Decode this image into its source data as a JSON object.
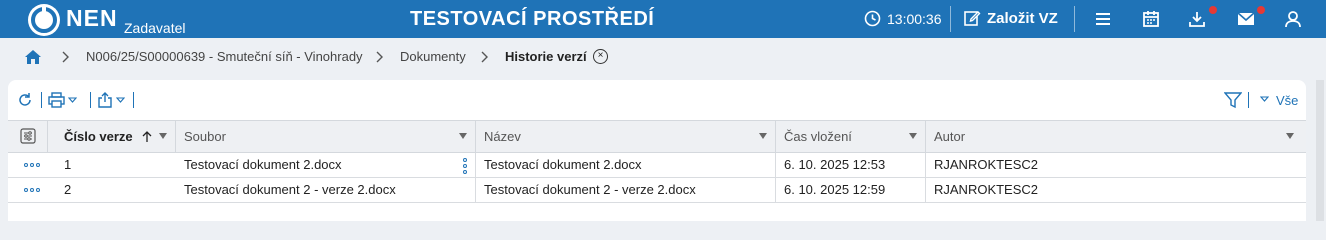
{
  "header": {
    "logo": "NEN",
    "role": "Zadavatel",
    "environment": "TESTOVACÍ PROSTŘEDÍ",
    "time": "13:00:36",
    "create_label": "Založit VZ",
    "icons": [
      "menu-icon",
      "calendar-icon",
      "download-icon",
      "mail-icon",
      "user-icon"
    ],
    "accent": "#1f73b7",
    "notification_color": "#e53935"
  },
  "breadcrumb": {
    "items": [
      "N006/25/S00000639 - Smuteční síň - Vinohrady",
      "Dokumenty",
      "Historie verzí"
    ],
    "close_symbol": "×"
  },
  "toolbar": {
    "filter_all": "Vše"
  },
  "table": {
    "columns": [
      "Číslo verze",
      "Soubor",
      "Název",
      "Čas vložení",
      "Autor"
    ],
    "rows": [
      {
        "verze": "1",
        "soubor": "Testovací dokument 2.docx",
        "nazev": "Testovací dokument 2.docx",
        "cas": "6. 10. 2025 12:53",
        "autor": "RJANROKTESC2"
      },
      {
        "verze": "2",
        "soubor": "Testovací dokument 2 - verze 2.docx",
        "nazev": "Testovací dokument 2 - verze 2.docx",
        "cas": "6. 10. 2025 12:59",
        "autor": "RJANROKTESC2"
      }
    ]
  }
}
